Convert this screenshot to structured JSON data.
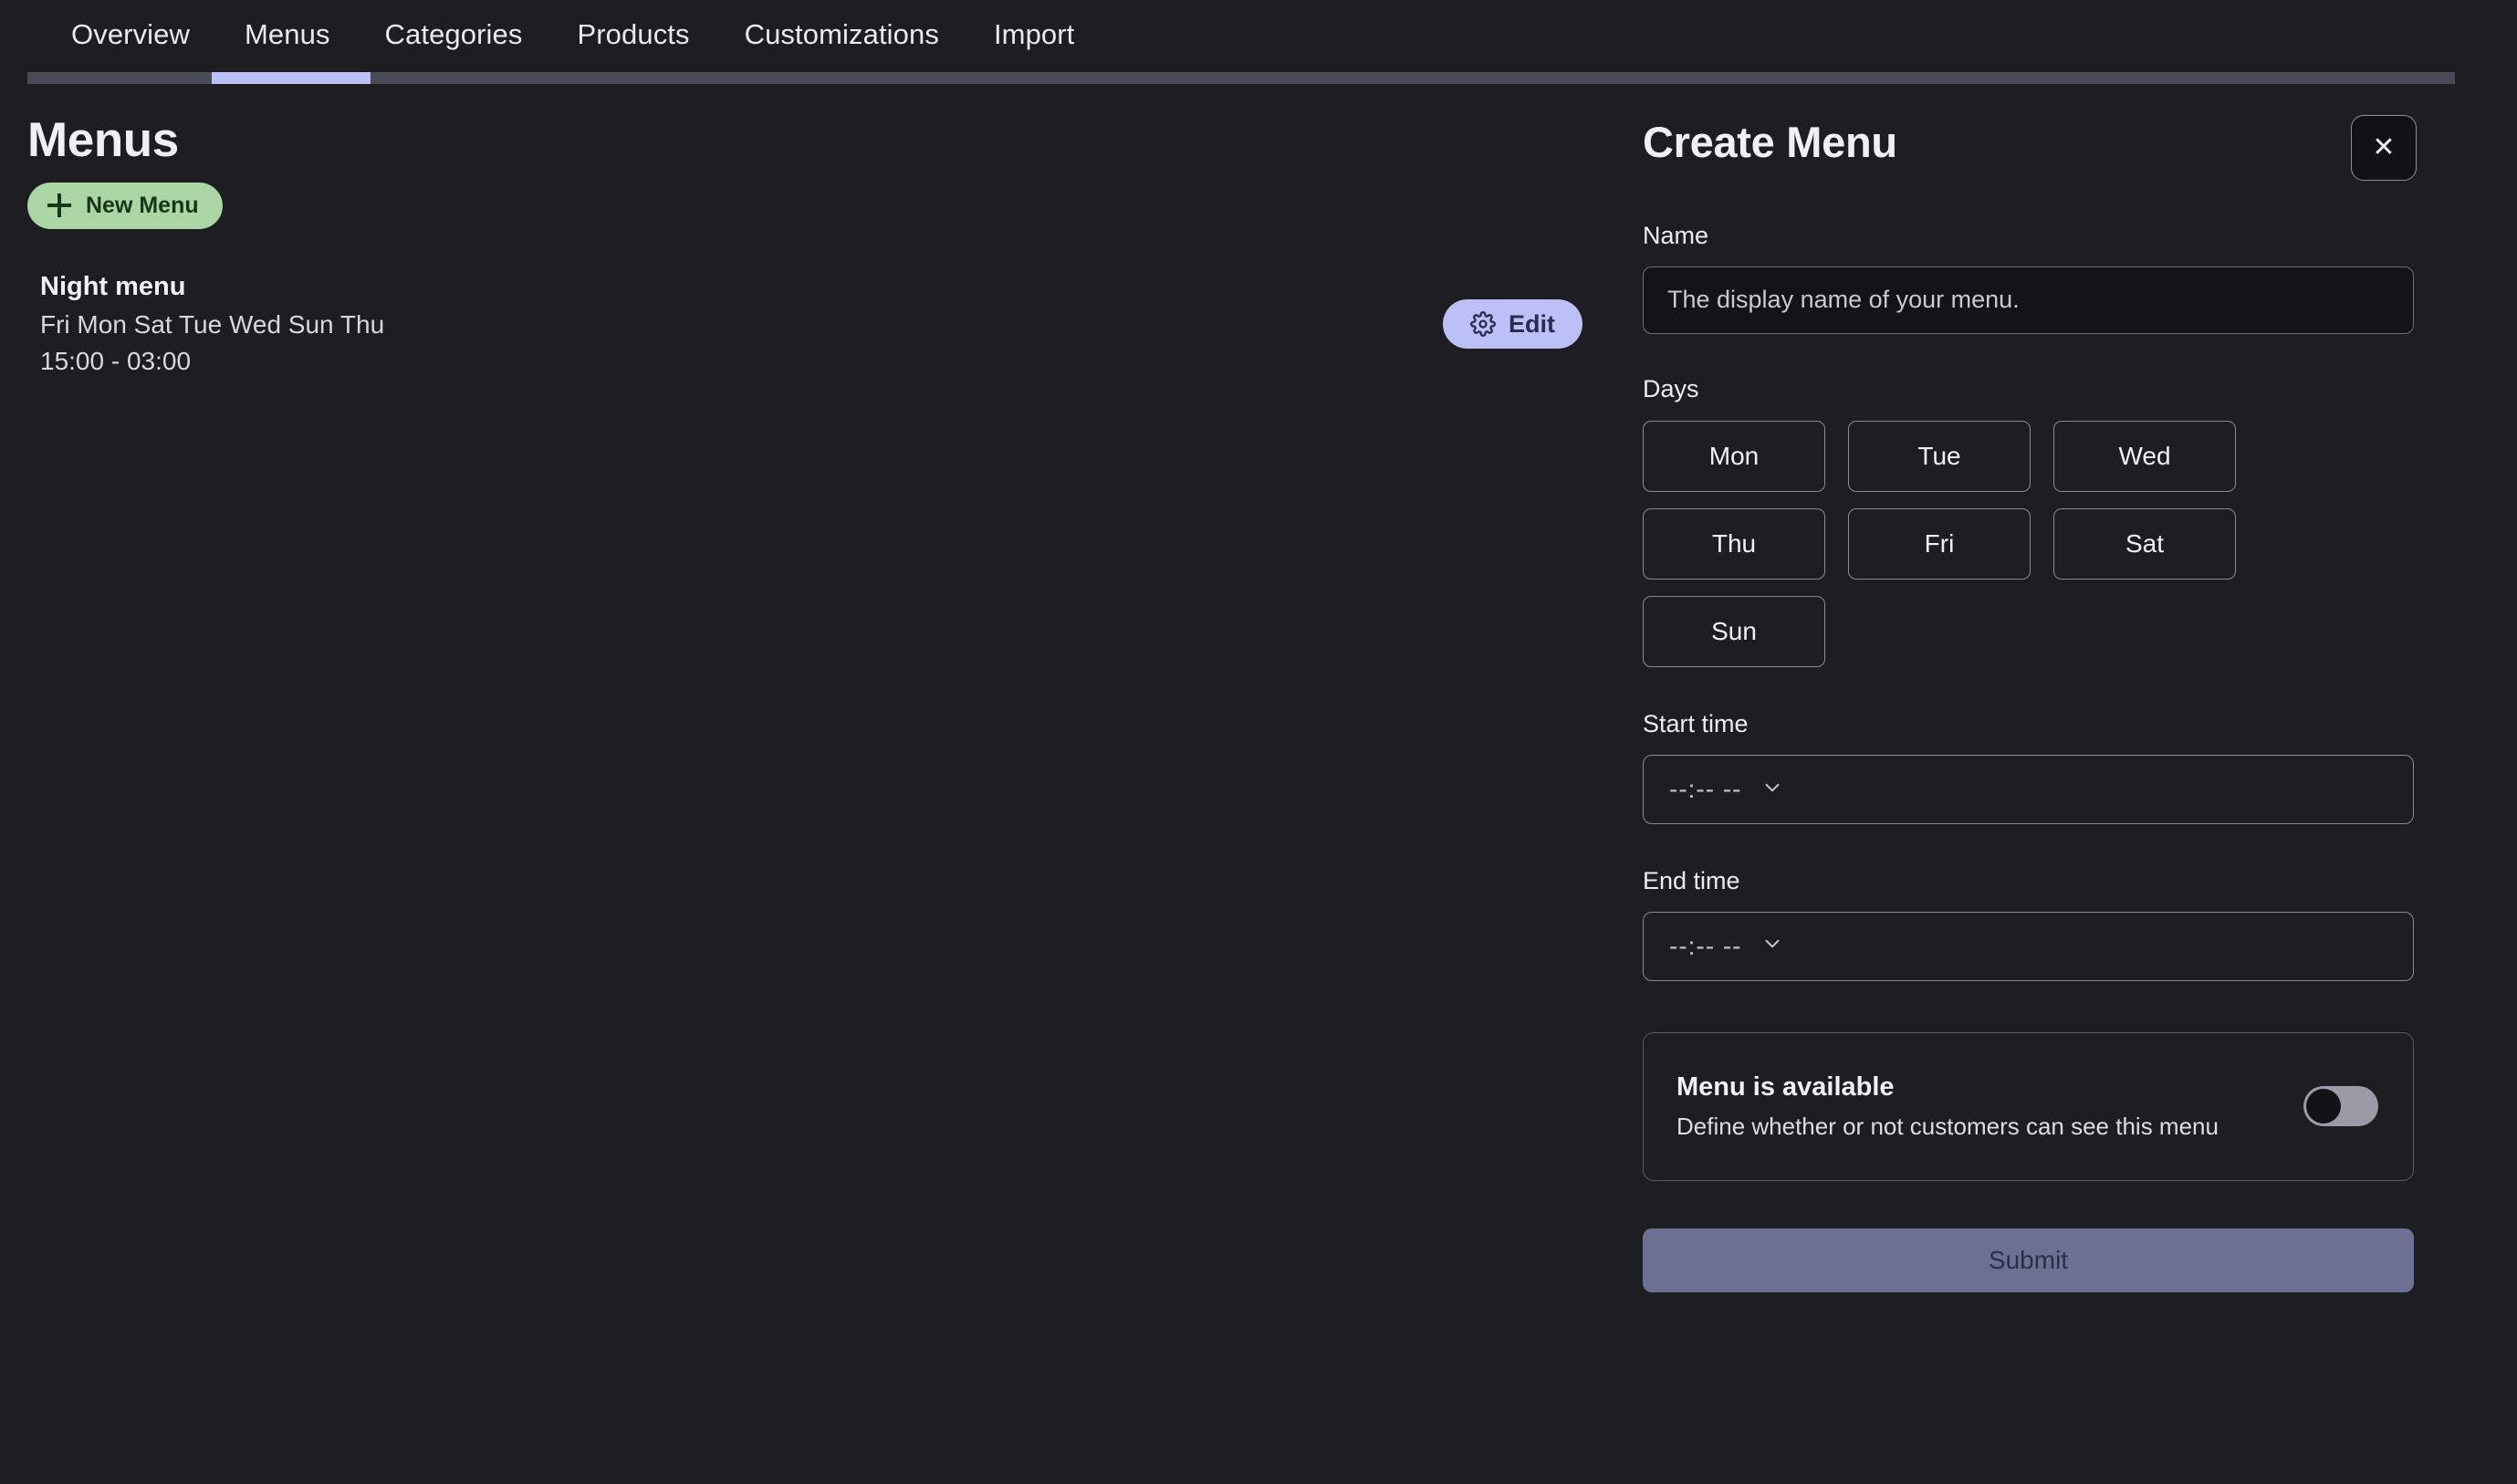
{
  "nav": {
    "tabs": [
      {
        "label": "Overview",
        "active": false
      },
      {
        "label": "Menus",
        "active": true
      },
      {
        "label": "Categories",
        "active": false
      },
      {
        "label": "Products",
        "active": false
      },
      {
        "label": "Customizations",
        "active": false
      },
      {
        "label": "Import",
        "active": false
      }
    ]
  },
  "left": {
    "page_title": "Menus",
    "new_menu_label": "New Menu",
    "new_menu_icon": "plus-icon",
    "menus": [
      {
        "name": "Night menu",
        "days": "Fri Mon Sat Tue Wed Sun Thu",
        "hours": "15:00 - 03:00",
        "edit_label": "Edit",
        "edit_icon": "gear-icon"
      }
    ]
  },
  "panel": {
    "title": "Create Menu",
    "close_icon": "close-icon",
    "close_label": "✕",
    "name_field": {
      "label": "Name",
      "value": "",
      "placeholder": "The display name of your menu."
    },
    "days_field": {
      "label": "Days",
      "options": [
        "Mon",
        "Tue",
        "Wed",
        "Thu",
        "Fri",
        "Sat",
        "Sun"
      ],
      "selected": []
    },
    "start_time": {
      "label": "Start time",
      "value": "--:-- --",
      "icon": "chevron-down-icon"
    },
    "end_time": {
      "label": "End time",
      "value": "--:-- --",
      "icon": "chevron-down-icon"
    },
    "availability": {
      "title": "Menu is available",
      "description": "Define whether or not customers can see this menu",
      "enabled": false
    },
    "submit_label": "Submit"
  },
  "colors": {
    "background": "#1e1e22",
    "accent_lavender": "#bcc0f7",
    "accent_green": "#a9d6a4",
    "submit_disabled": "#6e7093",
    "tab_track": "#484a56"
  }
}
